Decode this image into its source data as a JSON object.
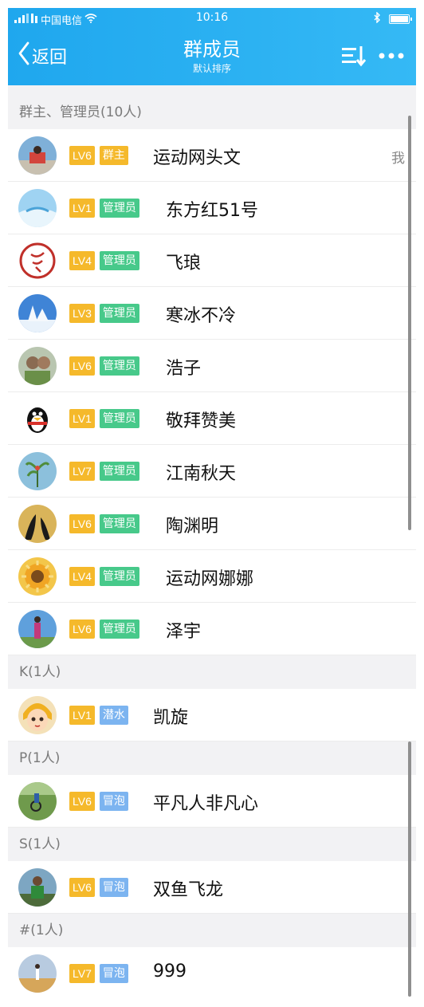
{
  "status": {
    "carrier": "中国电信",
    "time": "10:16"
  },
  "nav": {
    "back_label": "返回",
    "title": "群成员",
    "subtitle": "默认排序"
  },
  "sections": [
    {
      "header": "群主、管理员(10人)",
      "members": [
        {
          "level": "LV6",
          "role": "群主",
          "role_type": "owner",
          "name": "运动网头文",
          "me": "我"
        },
        {
          "level": "LV1",
          "role": "管理员",
          "role_type": "admin",
          "name": "东方红51号"
        },
        {
          "level": "LV4",
          "role": "管理员",
          "role_type": "admin",
          "name": "飞琅"
        },
        {
          "level": "LV3",
          "role": "管理员",
          "role_type": "admin",
          "name": "寒冰不冷"
        },
        {
          "level": "LV6",
          "role": "管理员",
          "role_type": "admin",
          "name": "浩子"
        },
        {
          "level": "LV1",
          "role": "管理员",
          "role_type": "admin",
          "name": "敬拜赞美"
        },
        {
          "level": "LV7",
          "role": "管理员",
          "role_type": "admin",
          "name": "江南秋天"
        },
        {
          "level": "LV6",
          "role": "管理员",
          "role_type": "admin",
          "name": "陶渊明"
        },
        {
          "level": "LV4",
          "role": "管理员",
          "role_type": "admin",
          "name": "运动网娜娜"
        },
        {
          "level": "LV6",
          "role": "管理员",
          "role_type": "admin",
          "name": "泽宇"
        }
      ]
    },
    {
      "header": "K(1人)",
      "members": [
        {
          "level": "LV1",
          "role": "潜水",
          "role_type": "lurk",
          "name": "凯旋"
        }
      ]
    },
    {
      "header": "P(1人)",
      "members": [
        {
          "level": "LV6",
          "role": "冒泡",
          "role_type": "bubble",
          "name": "平凡人非凡心"
        }
      ]
    },
    {
      "header": "S(1人)",
      "members": [
        {
          "level": "LV6",
          "role": "冒泡",
          "role_type": "bubble",
          "name": "双鱼飞龙"
        }
      ]
    },
    {
      "header": "#(1人)",
      "members": [
        {
          "level": "LV7",
          "role": "冒泡",
          "role_type": "bubble",
          "name": "999"
        }
      ]
    }
  ]
}
